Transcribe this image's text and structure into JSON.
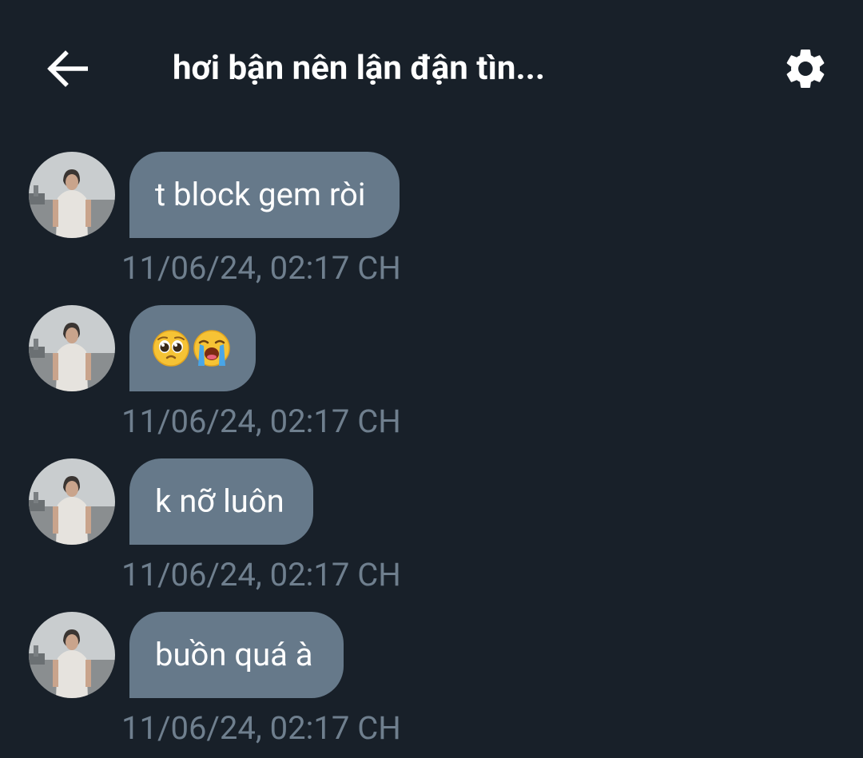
{
  "header": {
    "title": "hơi bận nên lận đận tìn...",
    "back_icon": "arrow-left-icon",
    "settings_icon": "gear-icon"
  },
  "colors": {
    "background": "#182029",
    "bubble": "#66798a",
    "timestamp": "#6f7f8e",
    "text": "#ffffff"
  },
  "messages": [
    {
      "text": "t block gem ròi",
      "timestamp": "11/06/24, 02:17 CH"
    },
    {
      "text": "",
      "emojis": [
        "pleading-face-icon",
        "loudly-crying-face-icon"
      ],
      "timestamp": "11/06/24, 02:17 CH"
    },
    {
      "text": "k nỡ luôn",
      "timestamp": "11/06/24, 02:17 CH"
    },
    {
      "text": "buồn quá à",
      "timestamp": "11/06/24, 02:17 CH"
    }
  ]
}
